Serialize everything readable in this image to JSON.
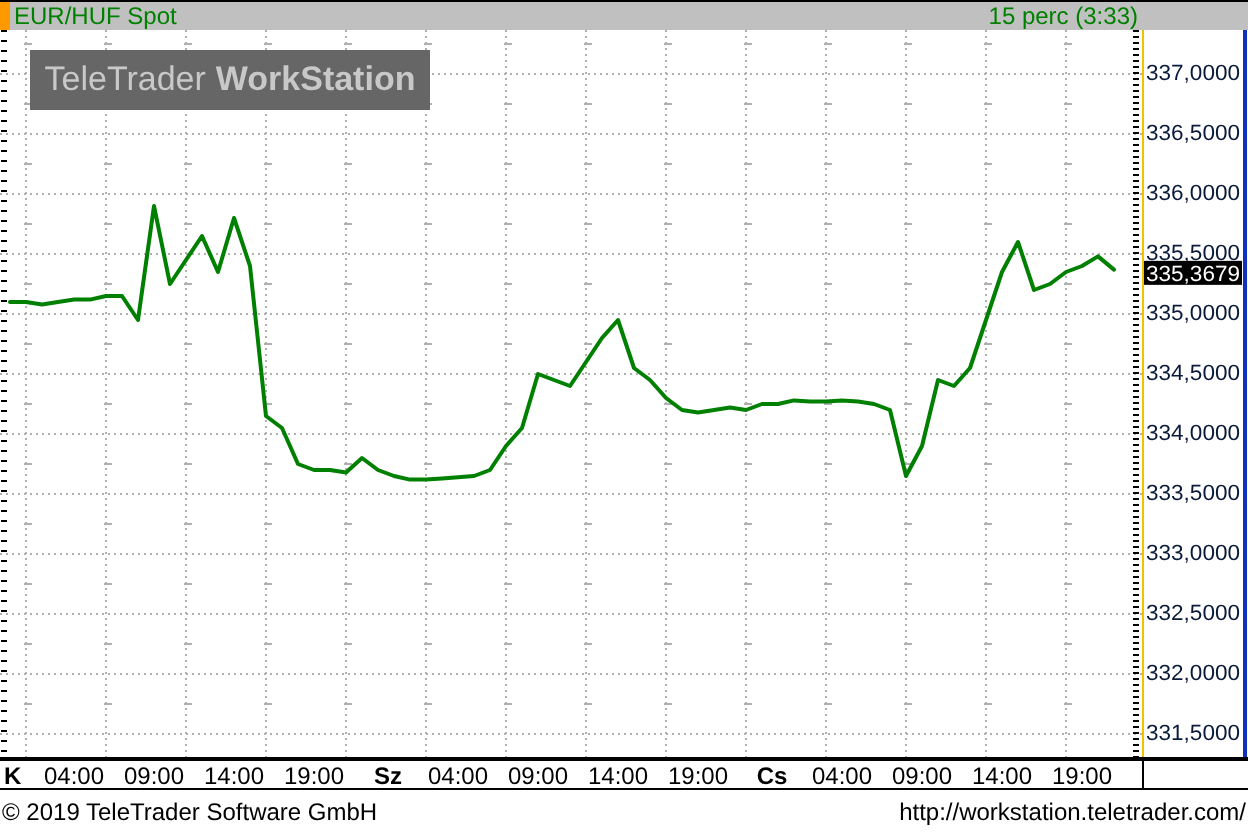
{
  "header": {
    "instrument": "EUR/HUF Spot",
    "interval": "15 perc (3:33)"
  },
  "logo": {
    "light": "TeleTrader",
    "bold": "WorkStation"
  },
  "chart": {
    "y_axis_labels": [
      "337,0000",
      "336,5000",
      "336,0000",
      "335,5000",
      "335,0000",
      "334,5000",
      "334,0000",
      "333,5000",
      "333,0000",
      "332,5000",
      "332,0000",
      "331,5000"
    ],
    "last_price": "335,3679",
    "x_axis_labels": [
      {
        "label": "K",
        "kind": "day"
      },
      {
        "label": "04:00",
        "kind": "hour"
      },
      {
        "label": "09:00",
        "kind": "hour"
      },
      {
        "label": "14:00",
        "kind": "hour"
      },
      {
        "label": "19:00",
        "kind": "hour"
      },
      {
        "label": "Sz",
        "kind": "day"
      },
      {
        "label": "04:00",
        "kind": "hour"
      },
      {
        "label": "09:00",
        "kind": "hour"
      },
      {
        "label": "14:00",
        "kind": "hour"
      },
      {
        "label": "19:00",
        "kind": "hour"
      },
      {
        "label": "Cs",
        "kind": "day"
      },
      {
        "label": "04:00",
        "kind": "hour"
      },
      {
        "label": "09:00",
        "kind": "hour"
      },
      {
        "label": "14:00",
        "kind": "hour"
      },
      {
        "label": "19:00",
        "kind": "hour"
      }
    ]
  },
  "footer": {
    "copyright": "© 2019 TeleTrader Software GmbH",
    "url": "http://workstation.teletrader.com/"
  }
}
